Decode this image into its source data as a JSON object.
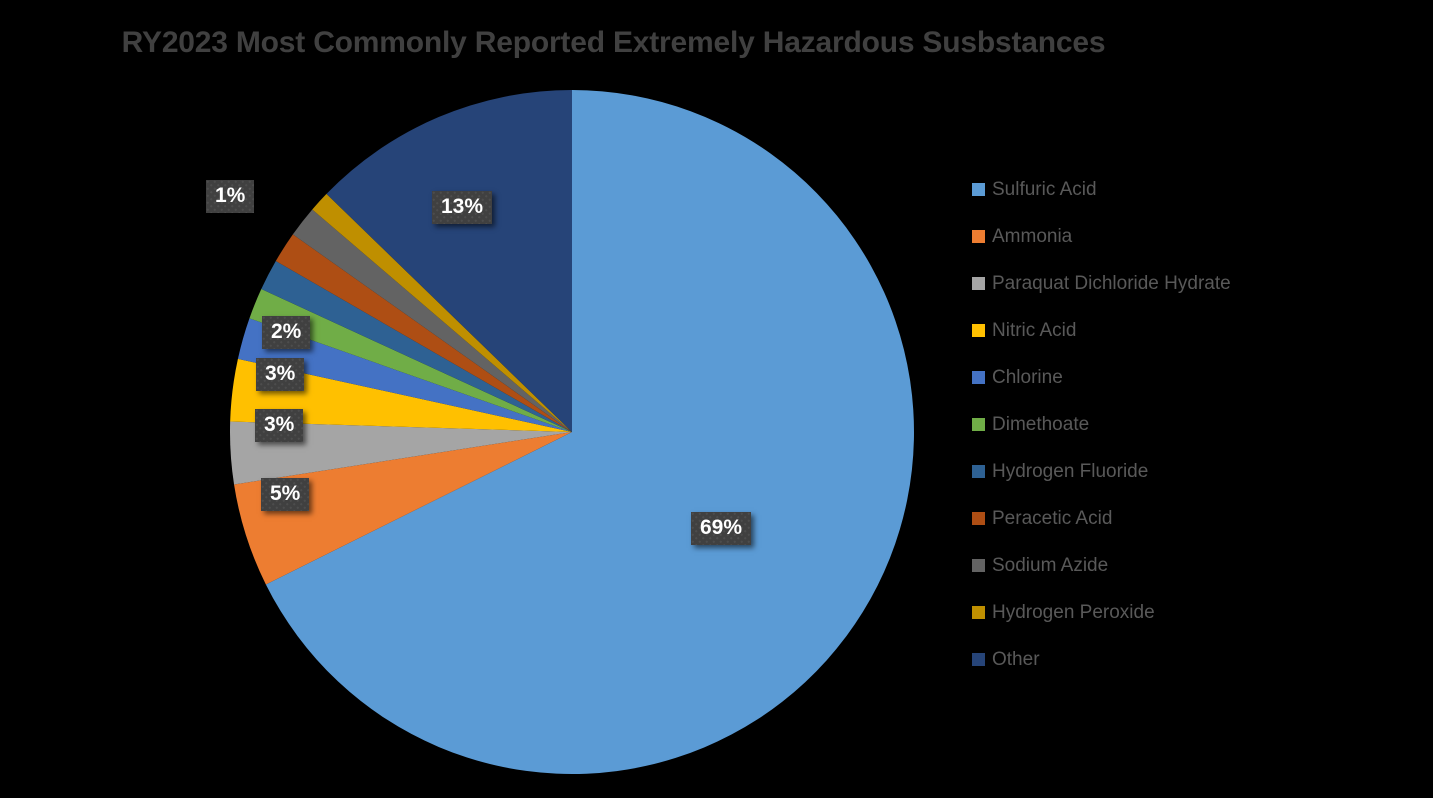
{
  "chart_data": {
    "type": "pie",
    "title": "RY2023 Most Commonly Reported Extremely Hazardous Susbstances",
    "xlabel": "",
    "ylabel": "",
    "legend_position": "right",
    "grid": false,
    "background_color": "#000000",
    "title_color": "#404040",
    "legend_text_color": "#595959",
    "data_label_bg": "#404040",
    "data_label_color": "#FFFFFF",
    "start_angle_deg": 0,
    "direction": "clockwise",
    "categories": [
      "Sulfuric Acid",
      "Ammonia",
      "Paraquat Dichloride Hydrate",
      "Nitric Acid",
      "Chlorine",
      "Dimethoate",
      "Hydrogen Fluoride",
      "Peracetic Acid",
      "Sodium Azide",
      "Hydrogen Peroxide",
      "Other"
    ],
    "values": [
      69,
      5,
      3,
      3,
      2,
      1.5,
      1.5,
      1.5,
      1.5,
      1,
      13
    ],
    "colors": [
      "#5B9BD5",
      "#ED7D31",
      "#A5A5A5",
      "#FFC000",
      "#4472C4",
      "#70AD47",
      "#2E6193",
      "#AE4E14",
      "#636363",
      "#BF8F00",
      "#264478"
    ],
    "shown_data_labels": [
      {
        "text": "69%",
        "slice": "Sulfuric Acid"
      },
      {
        "text": "5%",
        "slice": "Ammonia"
      },
      {
        "text": "3%",
        "slice": "Paraquat Dichloride Hydrate"
      },
      {
        "text": "3%",
        "slice": "Nitric Acid"
      },
      {
        "text": "2%",
        "slice": "Chlorine"
      },
      {
        "text": "1%",
        "slice": "Hydrogen Peroxide"
      },
      {
        "text": "13%",
        "slice": "Other"
      }
    ]
  },
  "title": {
    "text": "RY2023 Most Commonly Reported Extremely Hazardous Susbstances"
  },
  "labels": {
    "sulfuric_acid": "69%",
    "ammonia": "5%",
    "paraquat": "3%",
    "nitric_acid": "3%",
    "chlorine": "2%",
    "hydrogen_peroxide": "1%",
    "other": "13%"
  },
  "legend": {
    "items": [
      {
        "label": "Sulfuric Acid",
        "color": "#5B9BD5"
      },
      {
        "label": "Ammonia",
        "color": "#ED7D31"
      },
      {
        "label": "Paraquat Dichloride Hydrate",
        "color": "#A5A5A5"
      },
      {
        "label": "Nitric Acid",
        "color": "#FFC000"
      },
      {
        "label": "Chlorine",
        "color": "#4472C4"
      },
      {
        "label": "Dimethoate",
        "color": "#70AD47"
      },
      {
        "label": "Hydrogen Fluoride",
        "color": "#2E6193"
      },
      {
        "label": "Peracetic Acid",
        "color": "#AE4E14"
      },
      {
        "label": "Sodium Azide",
        "color": "#636363"
      },
      {
        "label": "Hydrogen Peroxide",
        "color": "#BF8F00"
      },
      {
        "label": "Other",
        "color": "#264478"
      }
    ]
  }
}
